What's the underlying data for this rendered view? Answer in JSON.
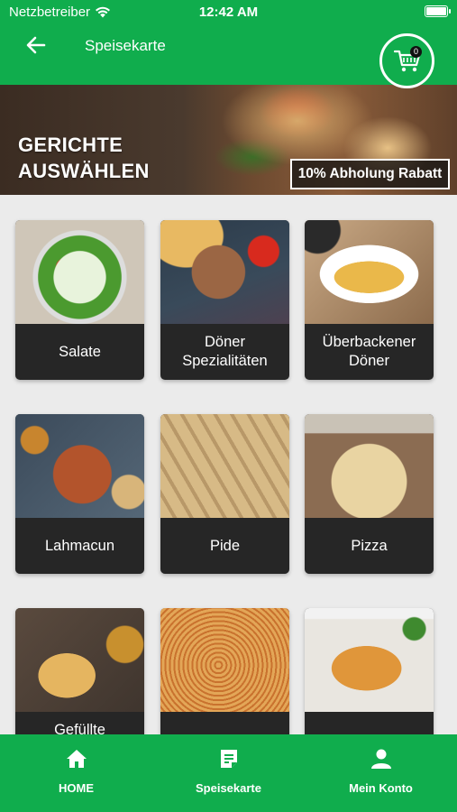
{
  "status_bar": {
    "carrier": "Netzbetreiber",
    "time": "12:42 AM"
  },
  "header": {
    "title": "Speisekarte",
    "cart_count": "0"
  },
  "banner": {
    "title_line1": "GERICHTE",
    "title_line2": "AUSWÄHLEN",
    "badge": "10% Abholung Rabatt"
  },
  "categories": [
    {
      "label": "Salate"
    },
    {
      "label": "Döner Spezialitäten"
    },
    {
      "label": "Überbackener Döner"
    },
    {
      "label": "Lahmacun"
    },
    {
      "label": "Pide"
    },
    {
      "label": "Pizza"
    },
    {
      "label": "Gefüllte"
    },
    {
      "label": ""
    },
    {
      "label": ""
    }
  ],
  "nav": [
    {
      "label": "HOME",
      "icon": "home-icon"
    },
    {
      "label": "Speisekarte",
      "icon": "menu-document-icon"
    },
    {
      "label": "Mein Konto",
      "icon": "user-icon"
    }
  ],
  "colors": {
    "brand_green": "#10ad4d",
    "card_dark": "#262626"
  }
}
